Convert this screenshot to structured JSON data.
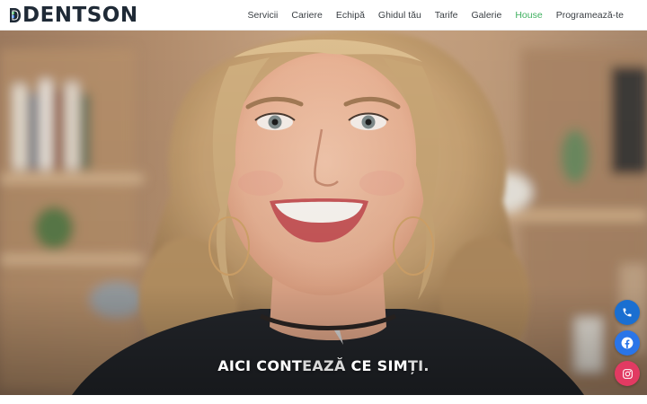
{
  "brand": {
    "name": "DENTSON",
    "colors": {
      "text": "#1f2a36",
      "mark_green": "#3fb05f",
      "mark_blue": "#2a75e8"
    }
  },
  "nav": {
    "items": [
      {
        "label": "Servicii"
      },
      {
        "label": "Cariere"
      },
      {
        "label": "Echipă"
      },
      {
        "label": "Ghidul tău"
      },
      {
        "label": "Tarife"
      },
      {
        "label": "Galerie"
      },
      {
        "label": "House",
        "active": true
      },
      {
        "label": "Programează-te"
      }
    ],
    "active_color": "#3fb05f",
    "language_icon": "us-flag-icon"
  },
  "hero": {
    "image": "smiling-woman-curly-hair-photo",
    "headline_parts": [
      {
        "text": "AICI CONT",
        "tone": "white"
      },
      {
        "text": "EAZĂ",
        "tone": "grey"
      },
      {
        "text": " CE SIM",
        "tone": "white"
      },
      {
        "text": "ȚI.",
        "tone": "grey"
      }
    ]
  },
  "floating_buttons": [
    {
      "icon": "phone-icon",
      "color": "#1a6fd1"
    },
    {
      "icon": "facebook-icon",
      "color": "#2a75e8"
    },
    {
      "icon": "instagram-icon",
      "color": "#e23a62"
    }
  ]
}
